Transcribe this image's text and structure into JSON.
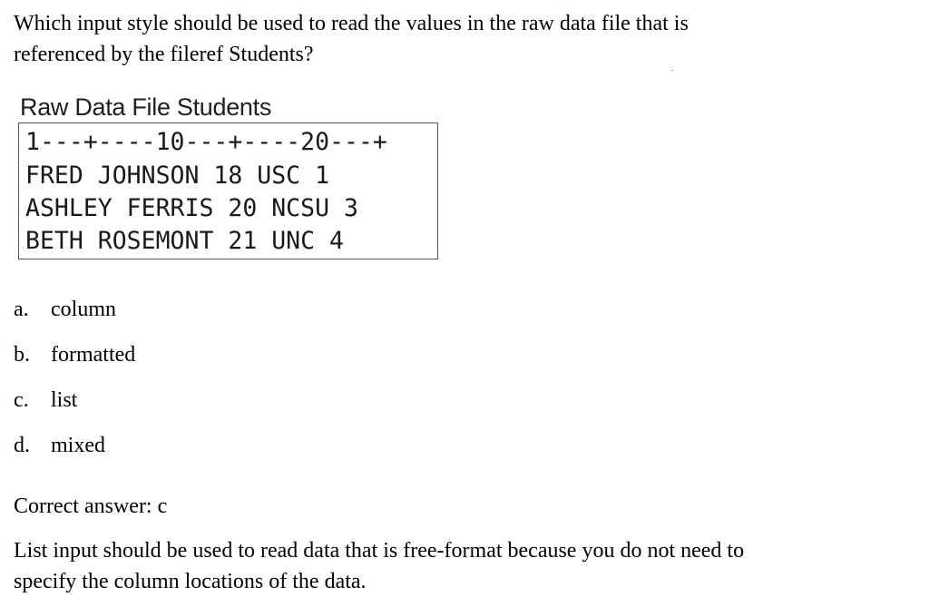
{
  "question": {
    "line1": "Which input style should be used to read the values in the raw data file that is",
    "line2": "referenced by the fileref Students?"
  },
  "raw_file": {
    "caption": "Raw Data File Students",
    "ruler": "1---+----10---+----20---+",
    "rows": [
      "FRED JOHNSON 18 USC 1",
      "ASHLEY FERRIS 20 NCSU 3",
      "BETH ROSEMONT 21 UNC 4"
    ]
  },
  "options": [
    {
      "letter": "a.",
      "text": "column"
    },
    {
      "letter": "b.",
      "text": "formatted"
    },
    {
      "letter": "c.",
      "text": "list"
    },
    {
      "letter": "d.",
      "text": "mixed"
    }
  ],
  "answer": "Correct answer: c",
  "explanation": {
    "line1": "List input should be used to read data that is free-format because you do not need to",
    "line2": "specify the column locations of the data."
  }
}
